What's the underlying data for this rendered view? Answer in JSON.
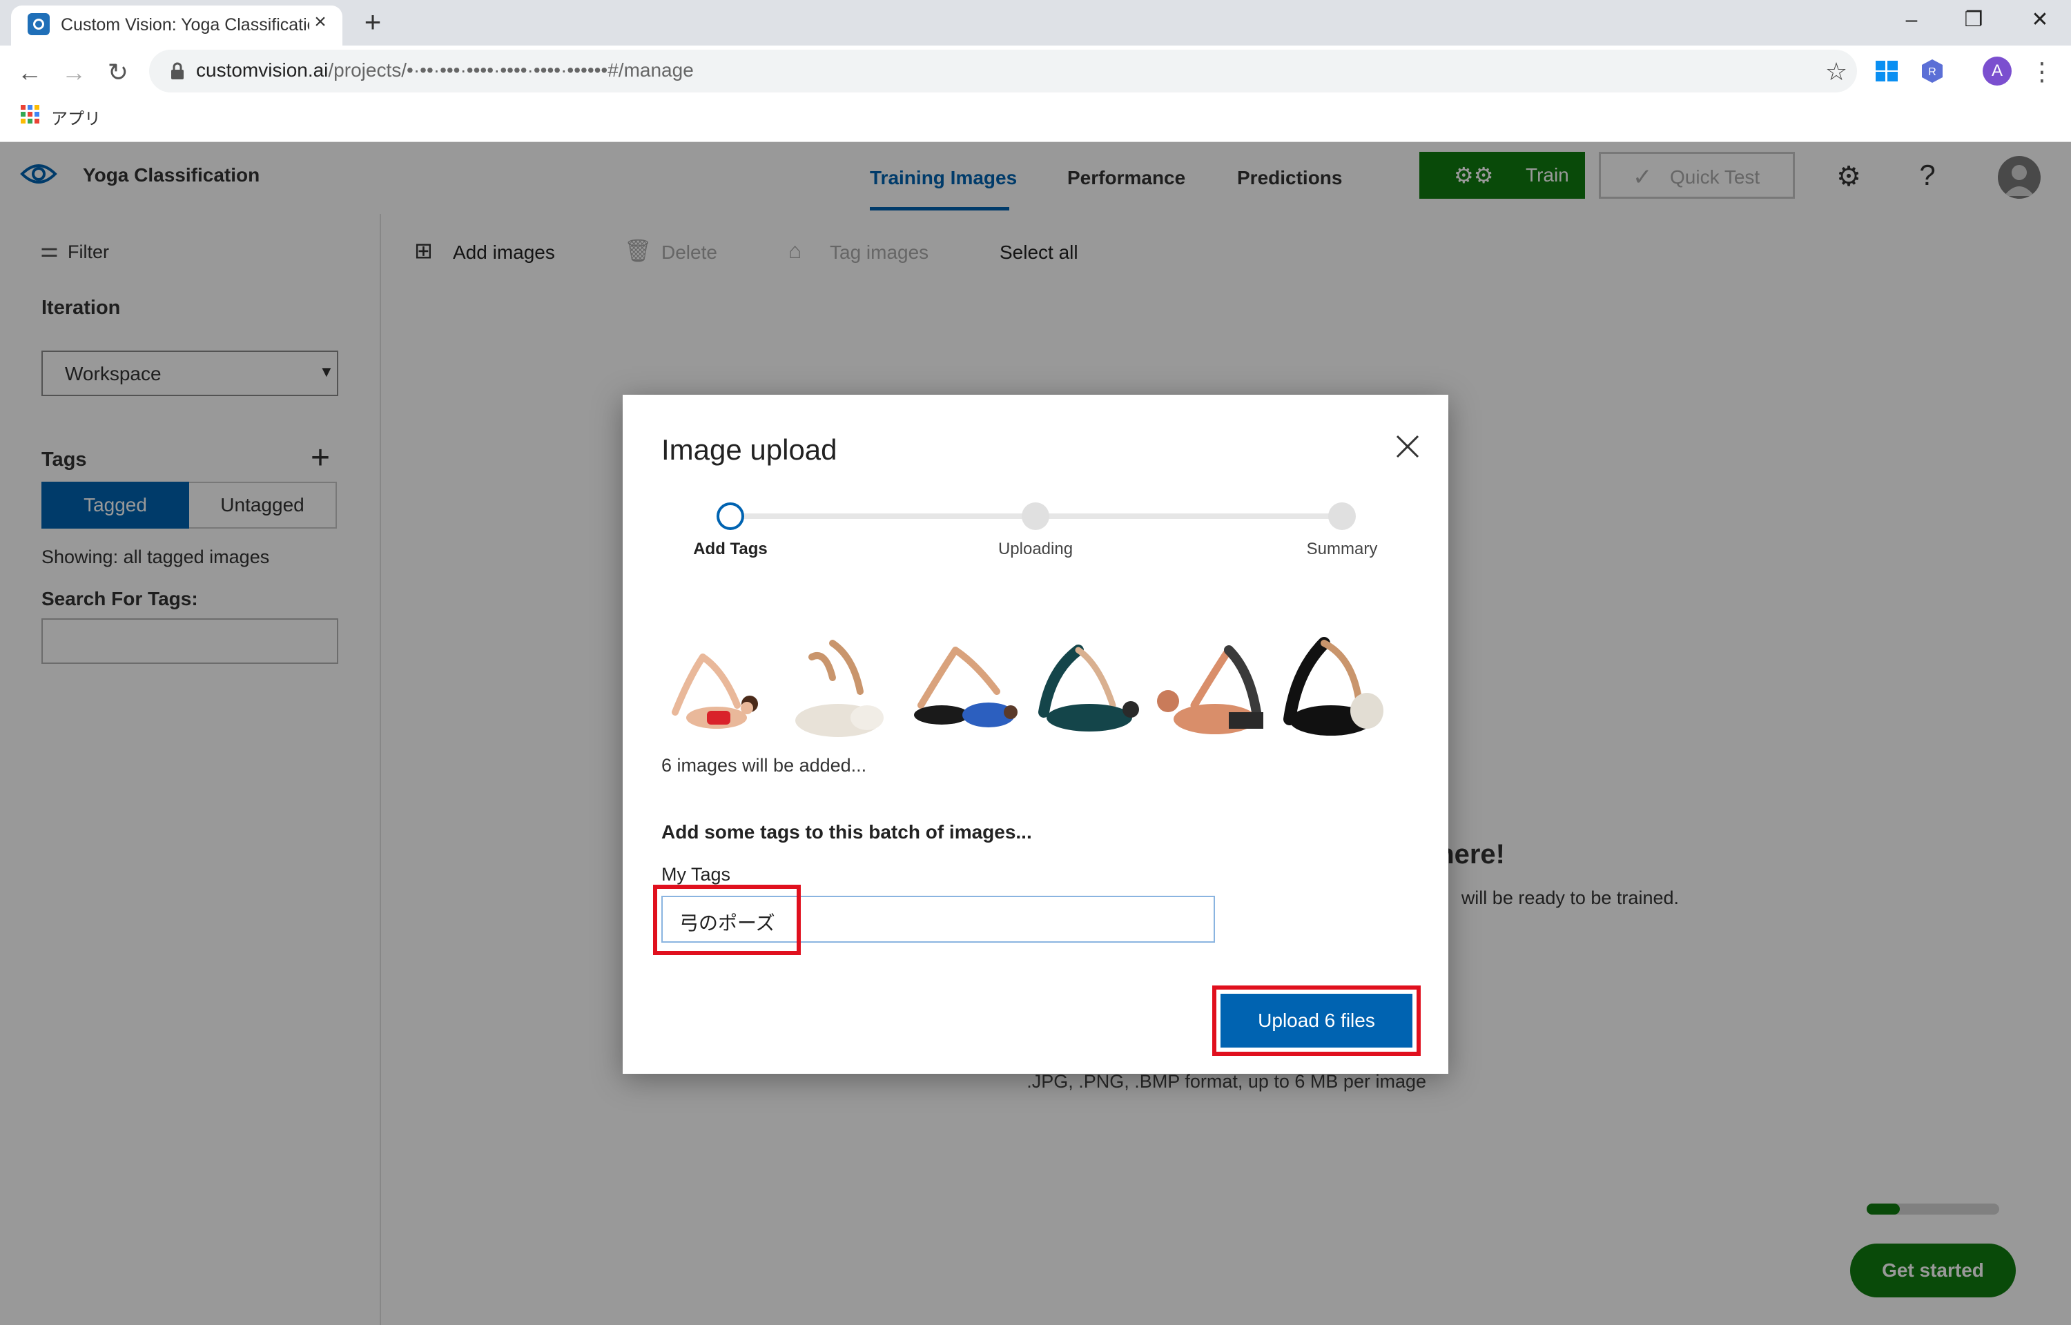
{
  "browser": {
    "tab_title": "Custom Vision: Yoga Classification",
    "url_host": "customvision.ai",
    "url_path": "/projects/",
    "url_masked": "•·••·•••·••••·••••·••••·••••••",
    "url_suffix": "#/manage",
    "bookmark_apps_label": "アプリ",
    "profile_initial": "A"
  },
  "app": {
    "project_name": "Yoga Classification",
    "tabs": [
      "Training Images",
      "Performance",
      "Predictions"
    ],
    "train_label": "Train",
    "quick_test_label": "Quick Test"
  },
  "sidebar": {
    "filter_label": "Filter",
    "iteration_label": "Iteration",
    "iteration_value": "Workspace",
    "tags_label": "Tags",
    "tagged_label": "Tagged",
    "untagged_label": "Untagged",
    "showing_label": "Showing: all tagged images",
    "search_tags_label": "Search For Tags:"
  },
  "commands": {
    "add_images": "Add images",
    "delete": "Delete",
    "tag_images": "Tag images",
    "select_all": "Select all"
  },
  "background": {
    "empty_heading_visible": "here!",
    "empty_sub_visible": "will be ready to be trained.",
    "formats_visible": ".JPG, .PNG, .BMP format, up to 6 MB per image",
    "progress_fraction": 0.25,
    "get_started_label": "Get started"
  },
  "modal": {
    "title": "Image upload",
    "steps": [
      "Add Tags",
      "Uploading",
      "Summary"
    ],
    "current_step": 0,
    "images_count_text": "6 images will be added...",
    "add_tags_heading": "Add some tags to this batch of images...",
    "my_tags_label": "My Tags",
    "tag_value": "弓のポーズ",
    "upload_label": "Upload 6 files"
  },
  "colors": {
    "accent_blue": "#0063b1",
    "train_green": "#107c10",
    "highlight_red": "#e0101e"
  }
}
